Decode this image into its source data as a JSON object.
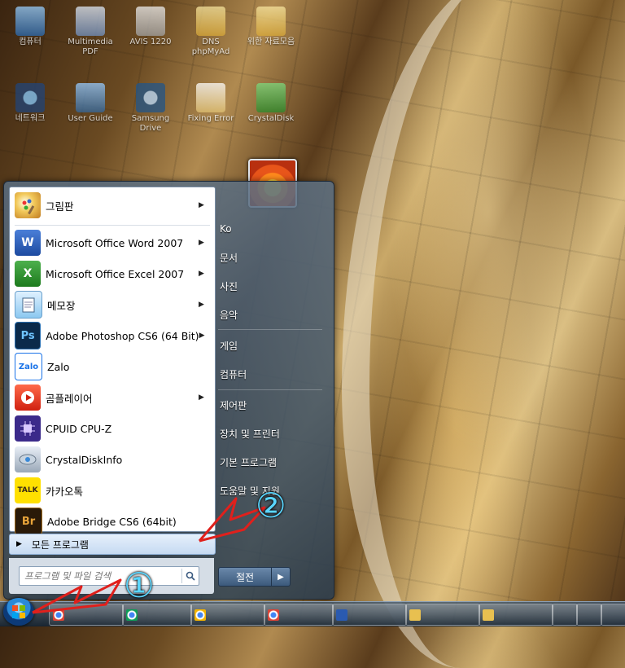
{
  "start_menu": {
    "programs": [
      {
        "label": "그림판",
        "icon": "paint-icon",
        "submenu": true
      },
      {
        "label": "Microsoft Office Word 2007",
        "icon": "word-icon",
        "submenu": true
      },
      {
        "label": "Microsoft Office Excel 2007",
        "icon": "excel-icon",
        "submenu": true
      },
      {
        "label": "메모장",
        "icon": "notepad-icon",
        "submenu": true
      },
      {
        "label": "Adobe Photoshop CS6 (64 Bit)",
        "icon": "photoshop-icon",
        "submenu": true
      },
      {
        "label": "Zalo",
        "icon": "zalo-icon",
        "submenu": false
      },
      {
        "label": "곰플레이어",
        "icon": "gomplayer-icon",
        "submenu": true
      },
      {
        "label": "CPUID CPU-Z",
        "icon": "cpuz-icon",
        "submenu": false
      },
      {
        "label": "CrystalDiskInfo",
        "icon": "crystaldiskinfo-icon",
        "submenu": false
      },
      {
        "label": "카카오톡",
        "icon": "kakaotalk-icon",
        "submenu": false
      },
      {
        "label": "Adobe Bridge CS6 (64bit)",
        "icon": "bridge-icon",
        "submenu": false
      }
    ],
    "icon_text": {
      "word": "W",
      "excel": "X",
      "photoshop": "Ps",
      "zalo": "Zalo",
      "kakaotalk": "TALK",
      "bridge": "Br"
    },
    "all_programs_label": "모든 프로그램",
    "search_placeholder": "프로그램 및 파일 검색",
    "right_items": [
      {
        "label": "Ko"
      },
      {
        "label": "문서"
      },
      {
        "label": "사진"
      },
      {
        "label": "음악"
      },
      {
        "label": "게임"
      },
      {
        "label": "컴퓨터"
      },
      {
        "label": "제어판"
      },
      {
        "label": "장치 및 프린터"
      },
      {
        "label": "기본 프로그램"
      },
      {
        "label": "도움말 및 지원"
      }
    ],
    "shutdown_label": "절전"
  },
  "desktop_icons": [
    {
      "label": "컴퓨터"
    },
    {
      "label": "Multimedia PDF"
    },
    {
      "label": "AVIS 1220"
    },
    {
      "label": "DNS phpMyAd"
    },
    {
      "label": "위한 자료모음"
    },
    {
      "label": "네트워크"
    },
    {
      "label": "User Guide"
    },
    {
      "label": "Samsung Drive"
    },
    {
      "label": "Fixing Error"
    },
    {
      "label": "CrystalDisk"
    }
  ],
  "annotations": {
    "marker_1": "①",
    "marker_2": "②",
    "arrow_color": "#e0201c"
  },
  "colors": {
    "accent": "#2a8ad8",
    "menu_glass": "#3c5a7c"
  }
}
